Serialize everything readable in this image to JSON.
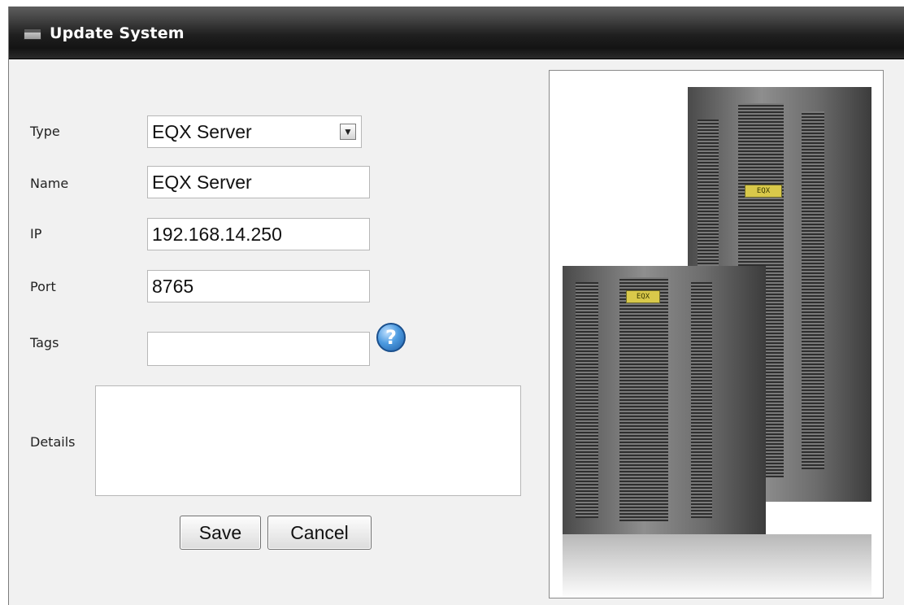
{
  "window": {
    "title": "Update System",
    "title_icon": "window-icon"
  },
  "form": {
    "type": {
      "label": "Type",
      "selected": "EQX Server"
    },
    "name": {
      "label": "Name",
      "value": "EQX Server"
    },
    "ip": {
      "label": "IP",
      "value": "192.168.14.250"
    },
    "port": {
      "label": "Port",
      "value": "8765"
    },
    "tags": {
      "label": "Tags",
      "value": "",
      "help_icon": "help-question-icon"
    },
    "details": {
      "label": "Details",
      "value": ""
    }
  },
  "buttons": {
    "save": "Save",
    "cancel": "Cancel"
  },
  "image": {
    "badge_text": "EQX"
  },
  "colors": {
    "titlebar": "#1f1f1f",
    "background": "#f1f1f1",
    "help_icon": "#3b86d1"
  }
}
